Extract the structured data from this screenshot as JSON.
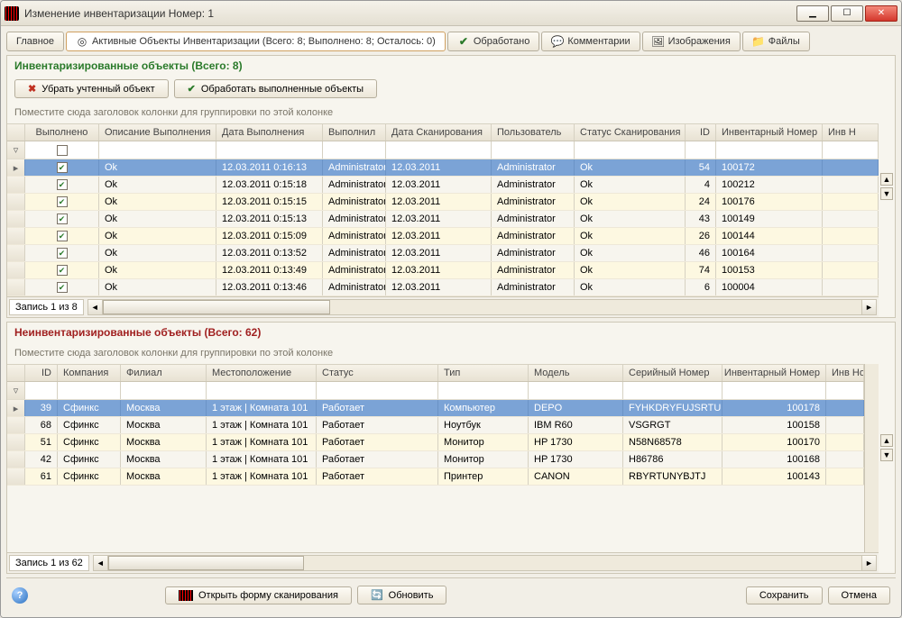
{
  "window": {
    "title": "Изменение инвентаризации Номер: 1"
  },
  "tabs": {
    "main": "Главное",
    "active": "Активные Объекты Инвентаризации (Всего: 8; Выполнено: 8; Осталось: 0)",
    "processed": "Обработано",
    "comments": "Комментарии",
    "images": "Изображения",
    "files": "Файлы"
  },
  "top": {
    "title": "Инвентаризированные объекты (Всего: 8)",
    "remove_btn": "Убрать учтенный объект",
    "process_btn": "Обработать выполненные объекты",
    "group_prompt": "Поместите сюда заголовок колонки для группировки по этой колонке",
    "columns": [
      "Выполнено",
      "Описание Выполнения",
      "Дата Выполнения",
      "Выполнил",
      "Дата Сканирования",
      "Пользователь",
      "Статус Сканирования",
      "ID",
      "Инвентарный Номер",
      "Инв Н"
    ],
    "rows": [
      {
        "done": true,
        "desc": "Ok",
        "date": "12.03.2011 0:16:13",
        "who": "Administrator",
        "scan": "12.03.2011",
        "user": "Administrator",
        "status": "Ok",
        "id": "54",
        "inv": "100172"
      },
      {
        "done": true,
        "desc": "Ok",
        "date": "12.03.2011 0:15:18",
        "who": "Administrator",
        "scan": "12.03.2011",
        "user": "Administrator",
        "status": "Ok",
        "id": "4",
        "inv": "100212"
      },
      {
        "done": true,
        "desc": "Ok",
        "date": "12.03.2011 0:15:15",
        "who": "Administrator",
        "scan": "12.03.2011",
        "user": "Administrator",
        "status": "Ok",
        "id": "24",
        "inv": "100176"
      },
      {
        "done": true,
        "desc": "Ok",
        "date": "12.03.2011 0:15:13",
        "who": "Administrator",
        "scan": "12.03.2011",
        "user": "Administrator",
        "status": "Ok",
        "id": "43",
        "inv": "100149"
      },
      {
        "done": true,
        "desc": "Ok",
        "date": "12.03.2011 0:15:09",
        "who": "Administrator",
        "scan": "12.03.2011",
        "user": "Administrator",
        "status": "Ok",
        "id": "26",
        "inv": "100144"
      },
      {
        "done": true,
        "desc": "Ok",
        "date": "12.03.2011 0:13:52",
        "who": "Administrator",
        "scan": "12.03.2011",
        "user": "Administrator",
        "status": "Ok",
        "id": "46",
        "inv": "100164"
      },
      {
        "done": true,
        "desc": "Ok",
        "date": "12.03.2011 0:13:49",
        "who": "Administrator",
        "scan": "12.03.2011",
        "user": "Administrator",
        "status": "Ok",
        "id": "74",
        "inv": "100153"
      },
      {
        "done": true,
        "desc": "Ok",
        "date": "12.03.2011 0:13:46",
        "who": "Administrator",
        "scan": "12.03.2011",
        "user": "Administrator",
        "status": "Ok",
        "id": "6",
        "inv": "100004"
      }
    ],
    "record_label": "Запись 1 из 8"
  },
  "bottom_sec": {
    "title": "Неинвентаризированные объекты (Всего: 62)",
    "group_prompt": "Поместите сюда заголовок колонки для группировки по этой колонке",
    "columns": [
      "ID",
      "Компания",
      "Филиал",
      "Местоположение",
      "Статус",
      "Тип",
      "Модель",
      "Серийный Номер",
      "Инвентарный Номер",
      "Инв Номер Б"
    ],
    "rows": [
      {
        "id": "39",
        "company": "Сфинкс",
        "branch": "Москва",
        "loc": "1 этаж | Комната 101",
        "status": "Работает",
        "type": "Компьютер",
        "model": "DEPO",
        "sn": "FYHKDRYFUJSRTUH",
        "inv": "100178"
      },
      {
        "id": "68",
        "company": "Сфинкс",
        "branch": "Москва",
        "loc": "1 этаж | Комната 101",
        "status": "Работает",
        "type": "Ноутбук",
        "model": "IBM R60",
        "sn": "VSGRGT",
        "inv": "100158"
      },
      {
        "id": "51",
        "company": "Сфинкс",
        "branch": "Москва",
        "loc": "1 этаж | Комната 101",
        "status": "Работает",
        "type": "Монитор",
        "model": "HP 1730",
        "sn": "N58N68578",
        "inv": "100170"
      },
      {
        "id": "42",
        "company": "Сфинкс",
        "branch": "Москва",
        "loc": "1 этаж | Комната 101",
        "status": "Работает",
        "type": "Монитор",
        "model": "HP 1730",
        "sn": "H86786",
        "inv": "100168"
      },
      {
        "id": "61",
        "company": "Сфинкс",
        "branch": "Москва",
        "loc": "1 этаж | Комната 101",
        "status": "Работает",
        "type": "Принтер",
        "model": "CANON",
        "sn": "RBYRTUNYBJTJ",
        "inv": "100143"
      }
    ],
    "record_label": "Запись 1 из 62"
  },
  "footer": {
    "scan_form": "Открыть форму сканирования",
    "refresh": "Обновить",
    "save": "Сохранить",
    "cancel": "Отмена"
  }
}
